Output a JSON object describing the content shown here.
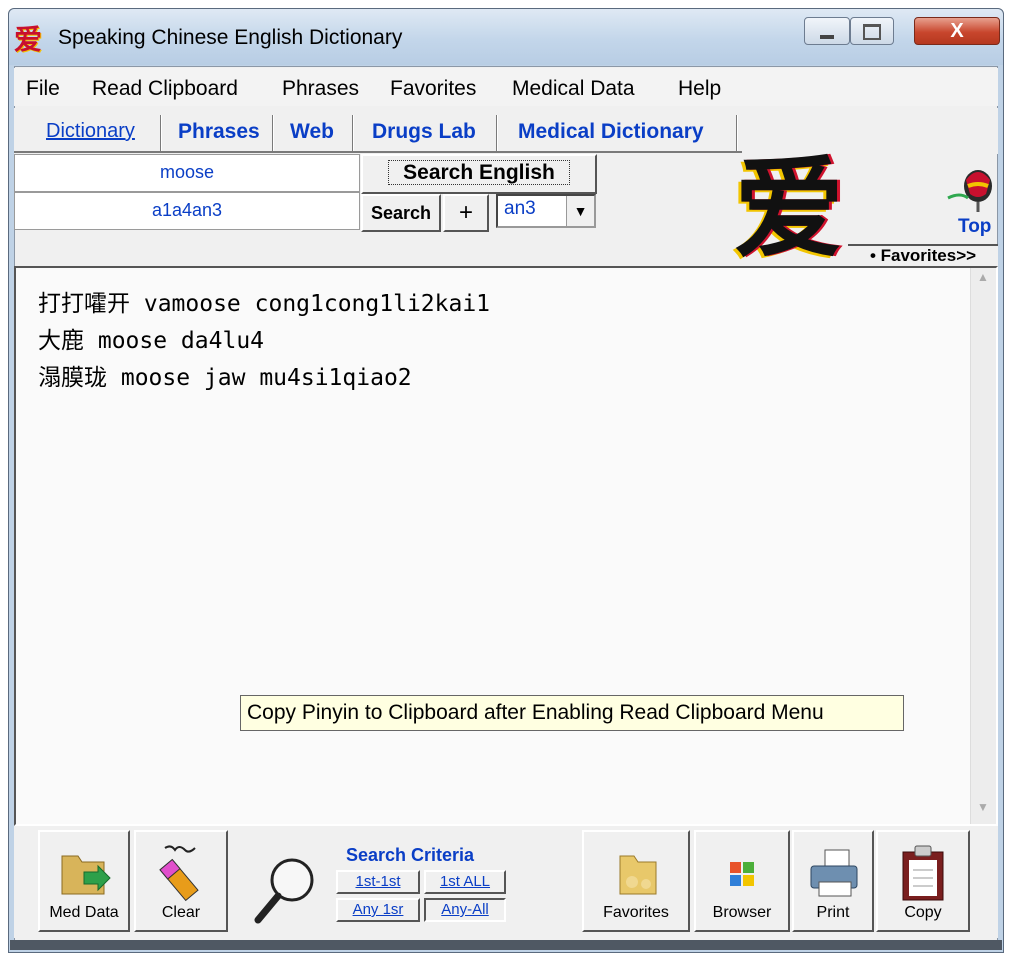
{
  "window": {
    "title": "Speaking Chinese English Dictionary",
    "icon": "ai-character-icon",
    "controls": [
      "minimize",
      "maximize",
      "close"
    ],
    "close_label": "X"
  },
  "menu": [
    "File",
    "Read Clipboard",
    "Phrases",
    "Favorites",
    "Medical Data",
    "Help"
  ],
  "tabs": [
    "Dictionary",
    "Phrases",
    "Web",
    "Drugs Lab",
    "Medical Dictionary"
  ],
  "search": {
    "english_value": "moose",
    "pinyin_value": "a1a4an3",
    "search_english_label": "Search English",
    "search_label": "Search",
    "plus_label": "+",
    "tone_selected": "an3"
  },
  "logo": {
    "character": "爱",
    "top_label": "Top",
    "favorites_label": "• Favorites>>"
  },
  "results": [
    "打打嚯开 vamoose cong1cong1li2kai1",
    "大鹿 moose da4lu4",
    "溻膜珑 moose jaw mu4si1qiao2"
  ],
  "tooltip": "Copy Pinyin to Clipboard after Enabling Read Clipboard Menu",
  "toolbar": {
    "med_data": "Med Data",
    "clear": "Clear",
    "criteria_title": "Search Criteria",
    "criteria": [
      "1st-1st",
      "1st ALL",
      "Any 1sr",
      "Any-All"
    ],
    "favorites": "Favorites",
    "browser": "Browser",
    "print": "Print",
    "copy": "Copy"
  },
  "colors": {
    "accent_blue": "#0a3ec6",
    "close_red": "#c8462d",
    "tooltip_bg": "#ffffe1"
  }
}
